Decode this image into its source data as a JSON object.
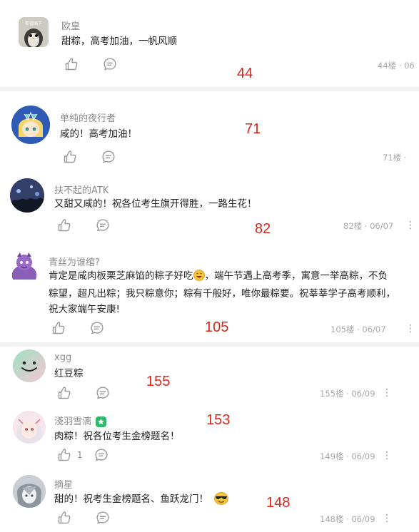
{
  "comments": [
    {
      "username": "欧皇",
      "text": "甜粽，高考加油，一帆风顺",
      "meta": "44楼 · 06",
      "annotation": "44",
      "avatar_caption": "带祖国下",
      "avatar_color": "#c9c6bd"
    },
    {
      "username": "单纯的夜行者",
      "text": "咸的！高考加油！",
      "meta": "71楼 · ",
      "annotation": "71",
      "avatar_color": "#3b64b8"
    },
    {
      "username": "扶不起的ATK",
      "text": "又甜又咸的！祝各位考生旗开得胜，一路生花！",
      "meta": "82楼 · 06/07",
      "annotation": "82",
      "avatar_color": "#2a3a5e"
    },
    {
      "username": "青丝为谁绾?",
      "text_line1": "肯定是咸肉板栗芝麻馅的粽子好吃",
      "text_line1_tail": "，端午节遇上高考季，寓意一举高粽，不负",
      "text_line2": "粽望，超凡出粽；我只粽意你；粽有千般好，唯你最粽要。祝莘莘学子高考顺利，",
      "text_line3": "祝大家端午安康!",
      "meta": "105楼 · 06/07",
      "annotation": "105",
      "avatar_color": "#8a5fb8"
    },
    {
      "username": "xgg",
      "text": "红豆粽",
      "meta": "155楼 · 06/09",
      "annotation": "155",
      "avatar_color": "#bde3c4"
    },
    {
      "username": "淺羽雪漓",
      "text": "肉粽！祝各位考生金榜题名！",
      "likes": "1",
      "meta": "149楼 · 06/09",
      "annotation": "153",
      "avatar_color": "#f0d6de"
    },
    {
      "username": "摘星",
      "text": "甜的！祝考生金榜题名、鱼跃龙门！",
      "meta": "148楼 · 06/09",
      "annotation": "148",
      "avatar_color": "#9aa3ad"
    }
  ],
  "more_icon": "⋮",
  "icons": [
    "like-icon",
    "reply-icon",
    "more-icon",
    "grin-emoji",
    "sunglasses-emoji",
    "verified-badge-icon"
  ],
  "annotation_color": "#d9261c"
}
